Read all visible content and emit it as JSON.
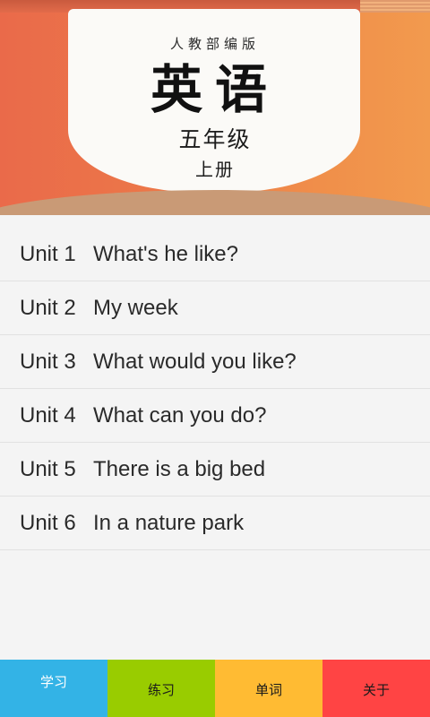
{
  "header": {
    "publisher": "人教部编版",
    "subject": "英语",
    "grade": "五年级",
    "volume": "上册"
  },
  "units": [
    {
      "number": "Unit 1",
      "title": "What's he like?"
    },
    {
      "number": "Unit 2",
      "title": "My week"
    },
    {
      "number": "Unit 3",
      "title": "What would you like?"
    },
    {
      "number": "Unit 4",
      "title": "What can you do?"
    },
    {
      "number": "Unit 5",
      "title": "There is a big bed"
    },
    {
      "number": "Unit 6",
      "title": "In a nature park"
    }
  ],
  "tabs": [
    {
      "label": "学习",
      "color": "#33b3e6",
      "active": true
    },
    {
      "label": "练习",
      "color": "#99cc00",
      "active": false
    },
    {
      "label": "单词",
      "color": "#ffbb33",
      "active": false
    },
    {
      "label": "关于",
      "color": "#ff4444",
      "active": false
    }
  ],
  "colors": {
    "banner_left": "#ea6a4a",
    "banner_right": "#f29a4e",
    "list_background": "#f4f4f4",
    "list_text": "#2a2a2a"
  }
}
